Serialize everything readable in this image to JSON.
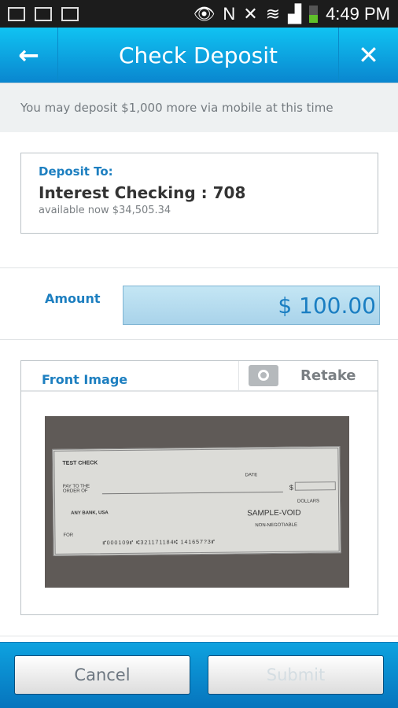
{
  "status": {
    "time": "4:49 PM"
  },
  "header": {
    "title": "Check Deposit",
    "back_icon": "arrow-left-icon",
    "close_icon": "close-icon"
  },
  "notice": "You may deposit $1,000 more via mobile at this time",
  "account": {
    "label": "Deposit To:",
    "name": "Interest Checking : 708",
    "available": "available now $34,505.34"
  },
  "amount": {
    "label": "Amount",
    "value": "$ 100.00"
  },
  "front_image": {
    "label": "Front Image",
    "retake": "Retake",
    "check": {
      "title": "TEST CHECK",
      "pay_to": "PAY TO THE ORDER OF",
      "date": "DATE",
      "dollar_sign": "$",
      "dollars": "DOLLARS",
      "bank": "ANY BANK, USA",
      "void": "SAMPLE-VOID",
      "non_negotiable": "NON-NEGOTIABLE",
      "for": "FOR",
      "micr": "⑈000109⑈ ⑆321171184⑆ 141657?3⑈"
    }
  },
  "footer": {
    "cancel": "Cancel",
    "submit": "Submit"
  },
  "colors": {
    "accent": "#1d7fc0",
    "header": "#0a9be0"
  }
}
